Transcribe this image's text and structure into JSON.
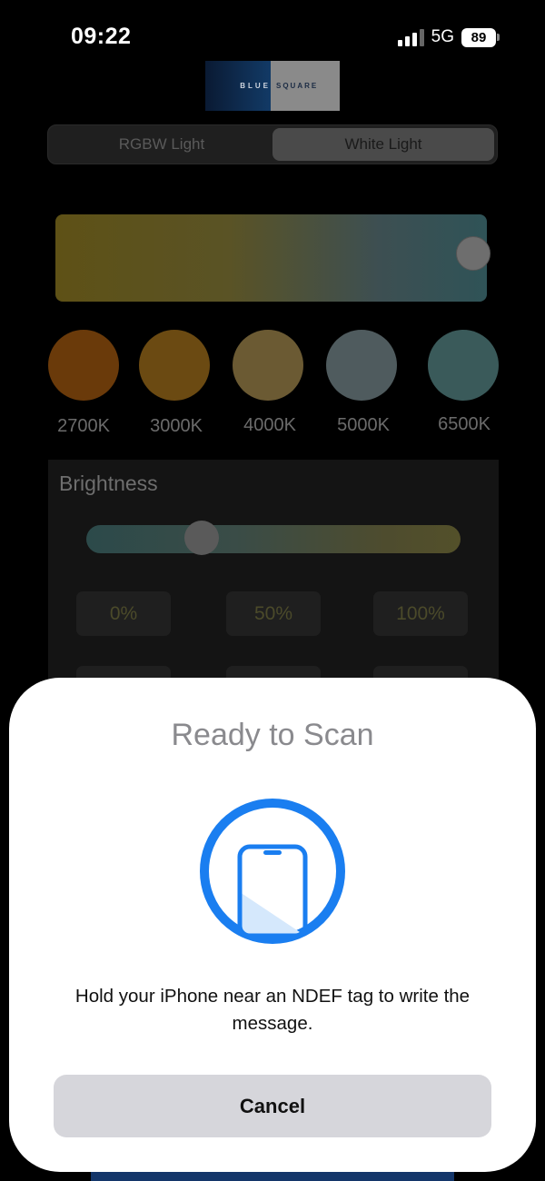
{
  "status_bar": {
    "time": "09:22",
    "network": "5G",
    "battery": "89"
  },
  "logo": {
    "part1": "BLUE",
    "part2": "SQUARE"
  },
  "mode_tabs": [
    {
      "label": "RGBW Light",
      "selected": false
    },
    {
      "label": "White Light",
      "selected": true
    }
  ],
  "color_temperature": {
    "value_fraction": 0.97
  },
  "presets": [
    {
      "label": "2700K",
      "color": "#6a3a0a"
    },
    {
      "label": "3000K",
      "color": "#6b4a12"
    },
    {
      "label": "4000K",
      "color": "#6b5a33"
    },
    {
      "label": "5000K",
      "color": "#4f5b5e"
    },
    {
      "label": "6500K",
      "color": "#3a5a5a"
    }
  ],
  "brightness": {
    "title": "Brightness",
    "value_fraction": 0.31,
    "buttons": [
      "0%",
      "50%",
      "100%"
    ]
  },
  "nfc_sheet": {
    "title": "Ready to Scan",
    "message": "Hold your iPhone near an NDEF tag to write the message.",
    "cancel_label": "Cancel",
    "accent_color": "#1a7ef0"
  }
}
